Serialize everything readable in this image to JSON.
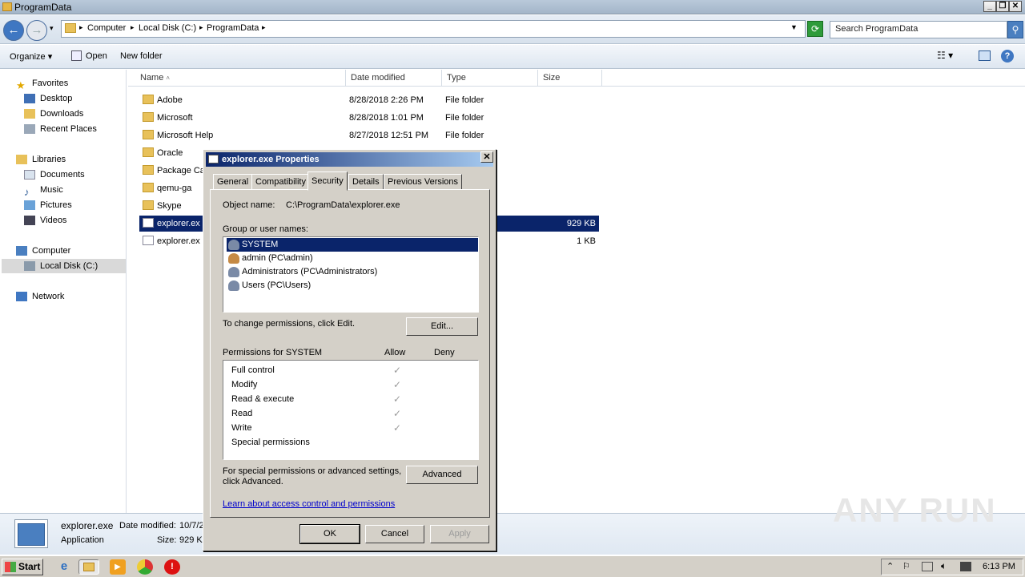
{
  "window": {
    "title": "ProgramData"
  },
  "address": {
    "crumbs": [
      "Computer",
      "Local Disk (C:)",
      "ProgramData"
    ],
    "search_placeholder": "Search ProgramData"
  },
  "toolbar": {
    "organize": "Organize",
    "open": "Open",
    "new_folder": "New folder"
  },
  "nav": {
    "favorites": "Favorites",
    "desktop": "Desktop",
    "downloads": "Downloads",
    "recent": "Recent Places",
    "libraries": "Libraries",
    "documents": "Documents",
    "music": "Music",
    "pictures": "Pictures",
    "videos": "Videos",
    "computer": "Computer",
    "local_disk": "Local Disk (C:)",
    "network": "Network"
  },
  "columns": {
    "name": "Name",
    "date": "Date modified",
    "type": "Type",
    "size": "Size"
  },
  "files": [
    {
      "name": "Adobe",
      "date": "8/28/2018 2:26 PM",
      "type": "File folder",
      "size": ""
    },
    {
      "name": "Microsoft",
      "date": "8/28/2018 1:01 PM",
      "type": "File folder",
      "size": ""
    },
    {
      "name": "Microsoft Help",
      "date": "8/27/2018 12:51 PM",
      "type": "File folder",
      "size": ""
    },
    {
      "name": "Oracle",
      "date": "",
      "type": "",
      "size": ""
    },
    {
      "name": "Package Ca",
      "date": "",
      "type": "",
      "size": ""
    },
    {
      "name": "qemu-ga",
      "date": "",
      "type": "",
      "size": ""
    },
    {
      "name": "Skype",
      "date": "",
      "type": "",
      "size": ""
    },
    {
      "name": "explorer.ex",
      "date": "",
      "type": "",
      "size": "929 KB"
    },
    {
      "name": "explorer.ex",
      "date": "",
      "type": "",
      "size": "1 KB"
    }
  ],
  "details": {
    "name": "explorer.exe",
    "modified_label": "Date modified:",
    "modified_value": "10/7/2",
    "type": "Application",
    "size_label": "Size:",
    "size_value": "929 KB"
  },
  "dialog": {
    "title": "explorer.exe Properties",
    "tabs": [
      "General",
      "Compatibility",
      "Security",
      "Details",
      "Previous Versions"
    ],
    "object_label": "Object name:",
    "object_value": "C:\\ProgramData\\explorer.exe",
    "group_label": "Group or user names:",
    "users": [
      "SYSTEM",
      "admin (PC\\admin)",
      "Administrators (PC\\Administrators)",
      "Users (PC\\Users)"
    ],
    "change_text": "To change permissions, click Edit.",
    "edit_btn": "Edit...",
    "perm_label": "Permissions for SYSTEM",
    "allow": "Allow",
    "deny": "Deny",
    "permissions": [
      {
        "name": "Full control",
        "allow": "✓"
      },
      {
        "name": "Modify",
        "allow": "✓"
      },
      {
        "name": "Read & execute",
        "allow": "✓"
      },
      {
        "name": "Read",
        "allow": "✓"
      },
      {
        "name": "Write",
        "allow": "✓"
      },
      {
        "name": "Special permissions",
        "allow": ""
      }
    ],
    "special_text_1": "For special permissions or advanced settings,",
    "special_text_2": "click Advanced.",
    "advanced_btn": "Advanced",
    "learn_link": "Learn about access control and permissions",
    "ok": "OK",
    "cancel": "Cancel",
    "apply": "Apply"
  },
  "taskbar": {
    "start": "Start",
    "clock": "6:13 PM"
  },
  "watermark": "ANY RUN"
}
